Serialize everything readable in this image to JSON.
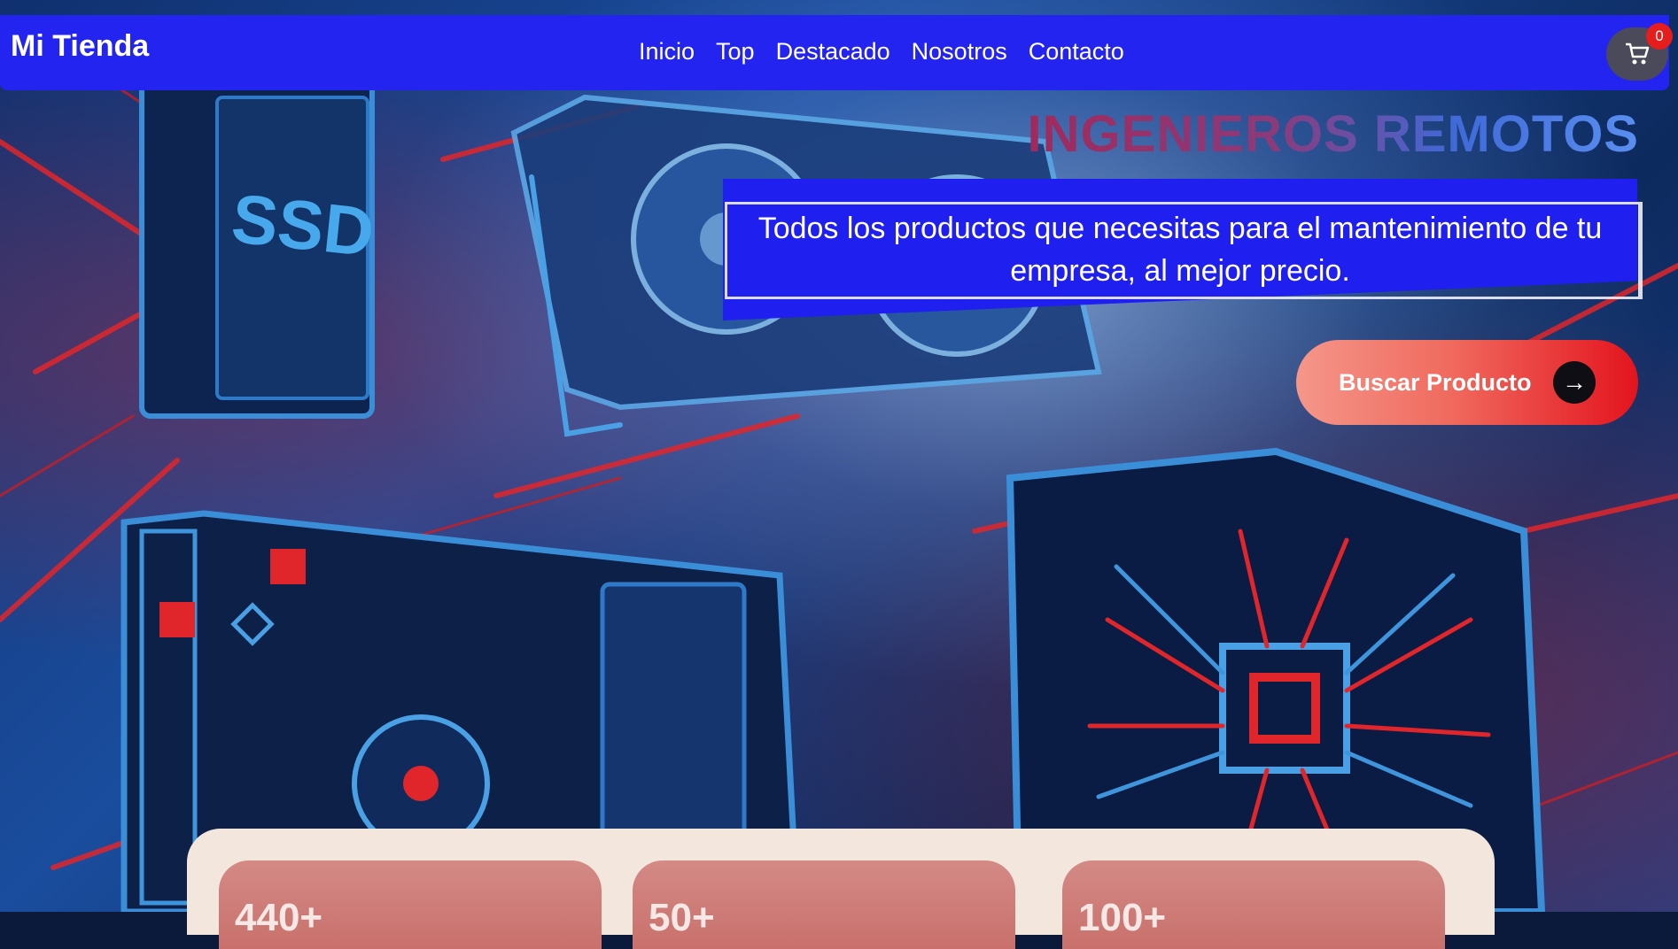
{
  "navbar": {
    "brand": "Mi Tienda",
    "links": [
      "Inicio",
      "Top",
      "Destacado",
      "Nosotros",
      "Contacto"
    ],
    "cart_count": "0"
  },
  "hero": {
    "title": "INGENIEROS REMOTOS",
    "tagline": "Todos los productos que necesitas para el mantenimiento de tu empresa, al mejor precio.",
    "search_button": "Buscar Producto",
    "illustration_text": "SSD"
  },
  "stats": [
    "440+",
    "50+",
    "100+"
  ],
  "colors": {
    "navbar": "#2424f0",
    "accent_red": "#e3141e",
    "panel_bg": "#f3e7dd",
    "stat_card": "#d48a86"
  },
  "icons": [
    "cart-icon",
    "arrow-right-icon"
  ]
}
